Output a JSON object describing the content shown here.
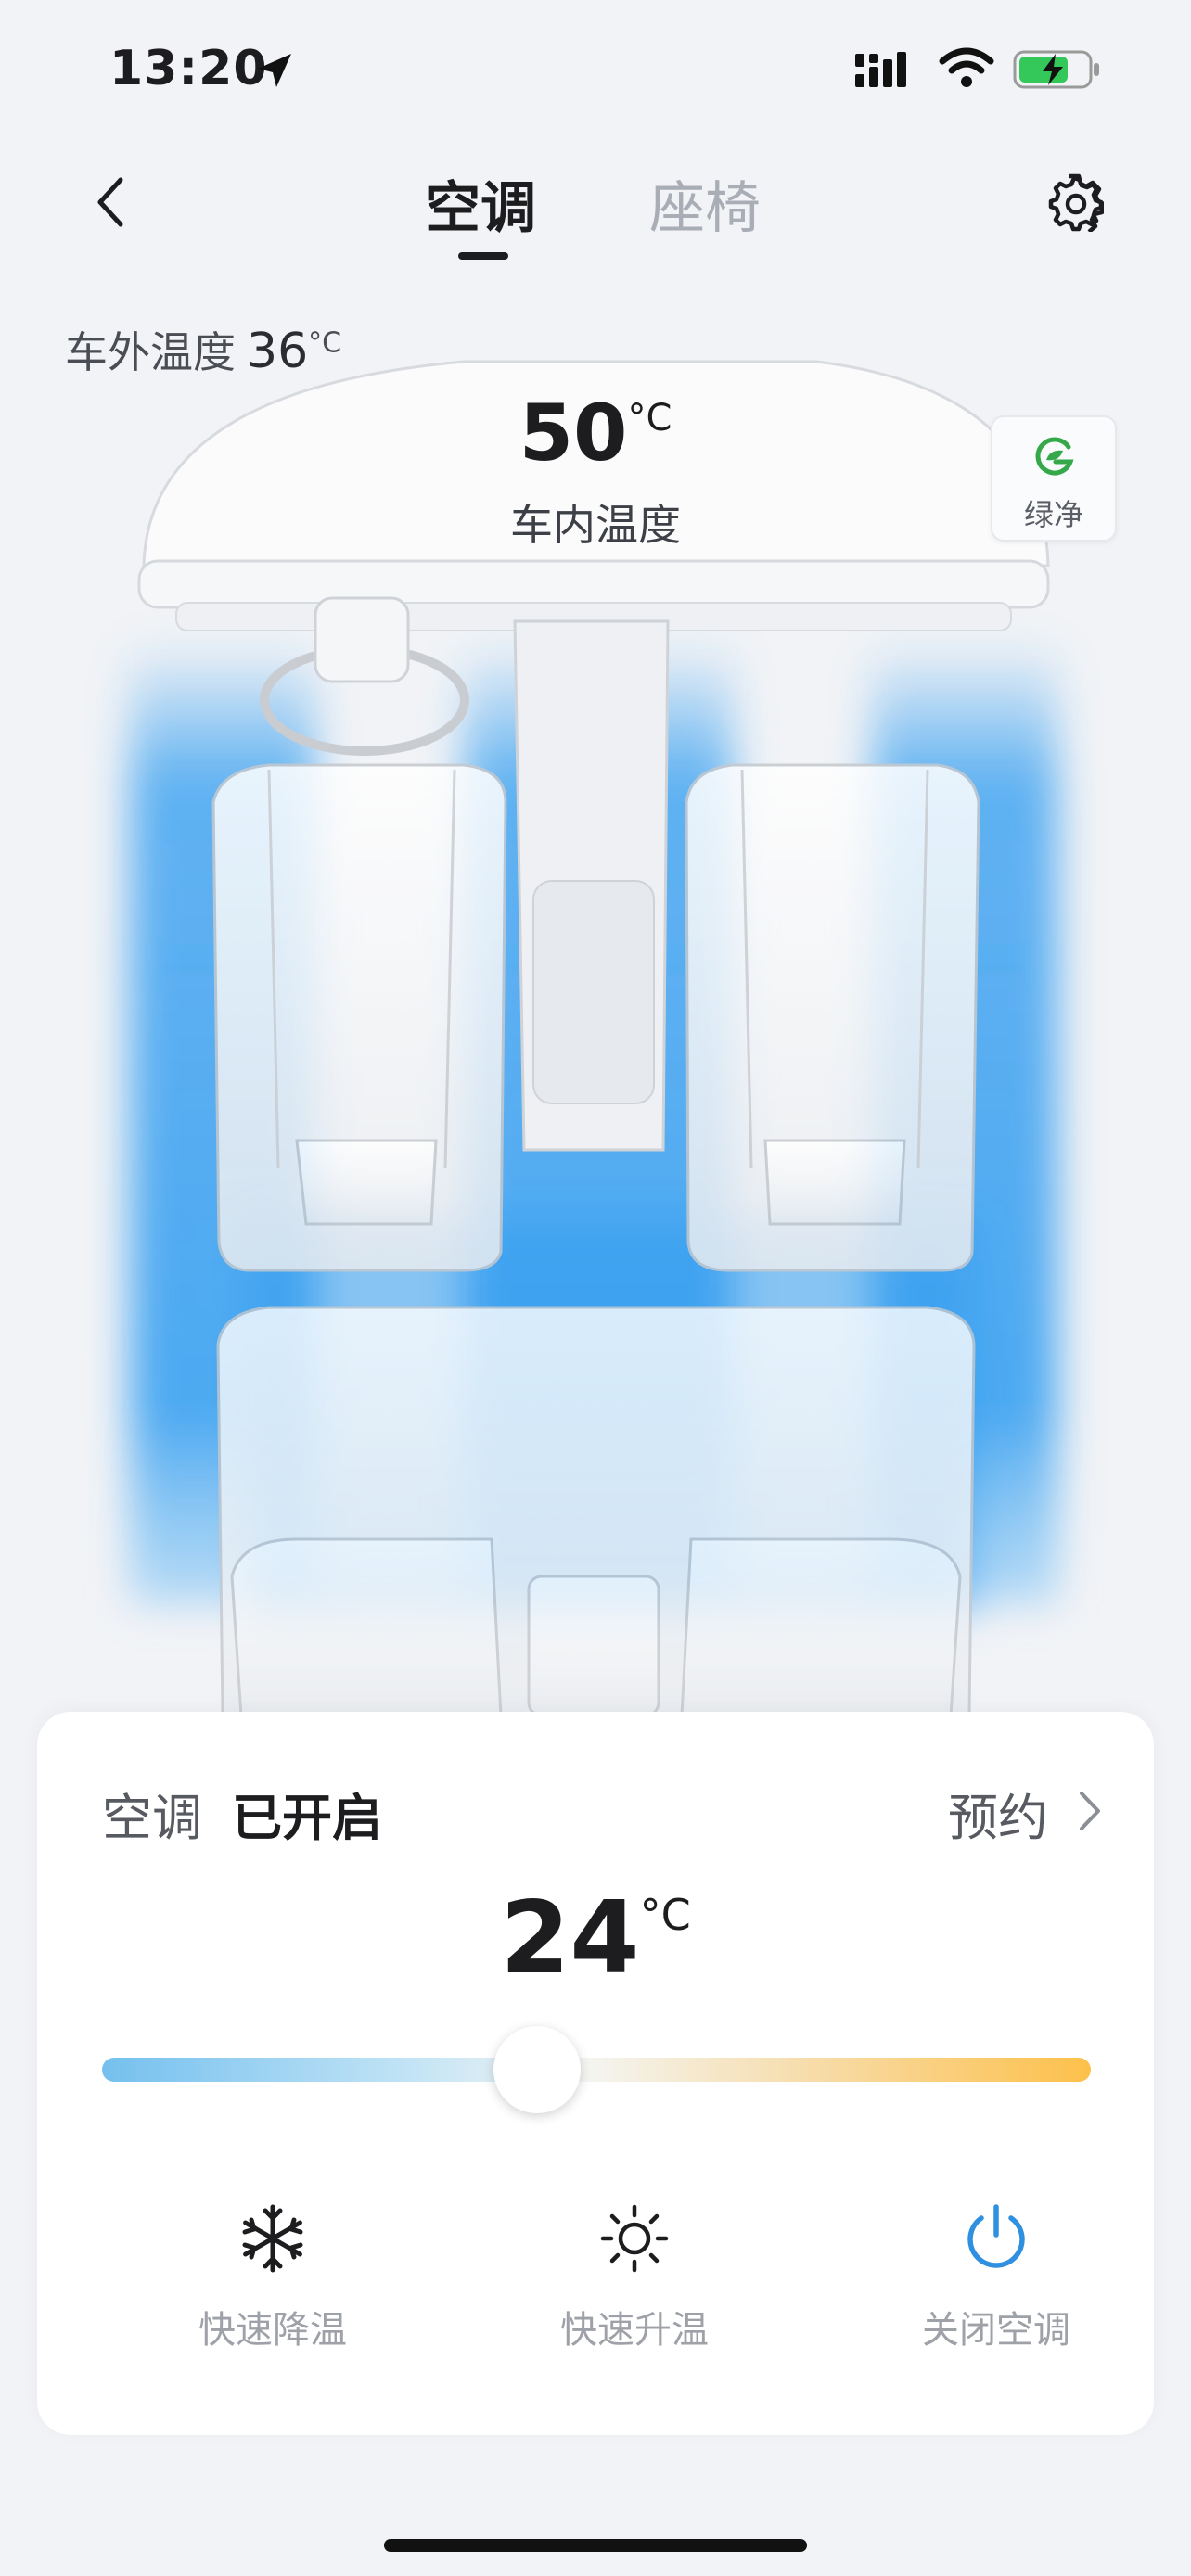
{
  "status_bar": {
    "time": "13:20",
    "icons": [
      "location-arrow-icon",
      "signal-icon",
      "wifi-icon",
      "battery-charging-icon"
    ]
  },
  "nav": {
    "back_icon": "chevron-left-icon",
    "tabs": [
      {
        "label": "空调",
        "active": true
      },
      {
        "label": "座椅",
        "active": false
      }
    ],
    "settings_icon": "gear-icon"
  },
  "outside": {
    "label": "车外温度",
    "value": "36",
    "unit": "°C"
  },
  "inside": {
    "value": "50",
    "unit": "°C",
    "label": "车内温度"
  },
  "green_clean": {
    "label": "绿净",
    "icon": "leaf-g-icon",
    "color": "#35a84a"
  },
  "control": {
    "title": "空调",
    "state": "已开启",
    "schedule_label": "预约",
    "set_temp": "24",
    "unit": "°C",
    "slider_fraction": 0.44,
    "actions": [
      {
        "label": "快速降温",
        "icon": "snowflake-icon"
      },
      {
        "label": "快速升温",
        "icon": "sun-icon"
      },
      {
        "label": "关闭空调",
        "icon": "power-icon",
        "color": "#2f8fe0"
      }
    ]
  },
  "colors": {
    "airflow_blue": "#2f9cf0",
    "accent_blue": "#2f8fe0",
    "warm_orange": "#fdc04b"
  }
}
